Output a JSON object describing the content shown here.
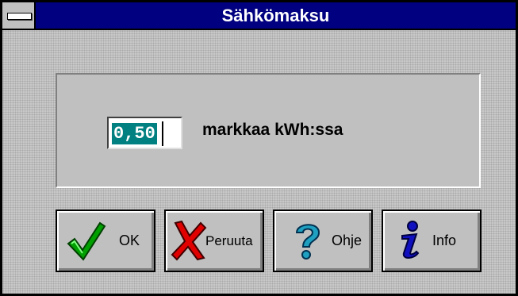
{
  "window": {
    "title": "Sähkömaksu"
  },
  "price": {
    "value": "0,50",
    "unit_label": "markkaa kWh:ssa"
  },
  "buttons": {
    "ok": {
      "label": "OK",
      "icon": "checkmark-icon"
    },
    "cancel": {
      "label": "Peruuta",
      "icon": "x-icon"
    },
    "help": {
      "label": "Ohje",
      "icon": "question-icon"
    },
    "info": {
      "label": "Info",
      "icon": "info-icon"
    }
  },
  "colors": {
    "titlebar": "#000080",
    "face": "#c0c0c0",
    "selection": "#008080",
    "ok_green": "#00a000",
    "cancel_red": "#e00000",
    "help_cyan": "#20a0c0",
    "info_blue": "#1010c0"
  }
}
